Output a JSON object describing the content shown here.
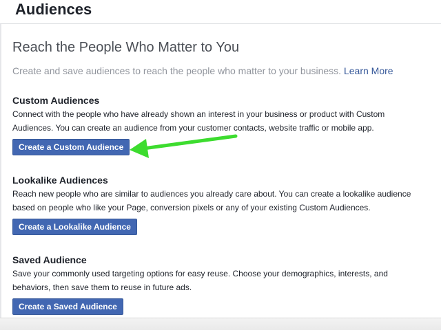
{
  "header": {
    "title": "Audiences"
  },
  "main": {
    "headline": "Reach the People Who Matter to You",
    "intro_text": "Create and save audiences to reach the people who matter to your business.",
    "learn_more_label": "Learn More"
  },
  "sections": [
    {
      "title": "Custom Audiences",
      "description_line1": "Connect with the people who have already shown an interest in your business or product with Custom",
      "description_line2": "Audiences. You can create an audience from your customer contacts, website traffic or mobile app.",
      "button_label": "Create a Custom Audience"
    },
    {
      "title": "Lookalike Audiences",
      "description_line1": "Reach new people who are similar to audiences you already care about. You can create a lookalike audience",
      "description_line2": "based on people who like your Page, conversion pixels or any of your existing Custom Audiences.",
      "button_label": "Create a Lookalike Audience"
    },
    {
      "title": "Saved Audience",
      "description_line1": "Save your commonly used targeting options for easy reuse. Choose your demographics, interests, and",
      "description_line2": "behaviors, then save them to reuse in future ads.",
      "button_label": "Create a Saved Audience"
    }
  ],
  "colors": {
    "button_bg": "#4267b2",
    "link": "#365899",
    "annotation_arrow": "#3ddc2f"
  },
  "annotation": {
    "icon": "green-arrow-icon"
  }
}
